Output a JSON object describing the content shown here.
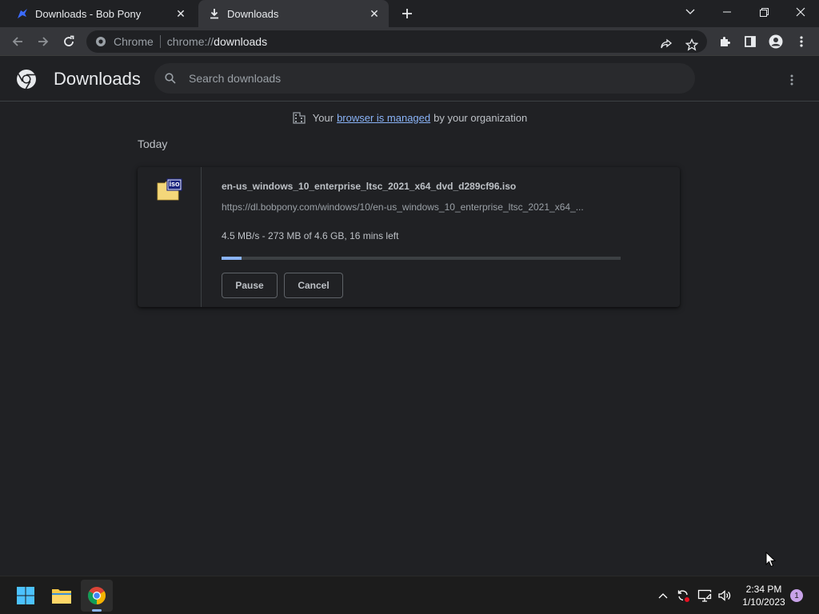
{
  "tabs": [
    {
      "title": "Downloads - Bob Pony",
      "close": "✕"
    },
    {
      "title": "Downloads",
      "close": "✕"
    }
  ],
  "new_tab": "+",
  "omnibox": {
    "site_name": "Chrome",
    "url_scheme": "chrome://",
    "url_host": "downloads"
  },
  "page": {
    "title": "Downloads",
    "search_placeholder": "Search downloads"
  },
  "managed_notice": {
    "prefix": "Your",
    "link": "browser is managed",
    "suffix": "by your organization"
  },
  "section_date": "Today",
  "download": {
    "filename": "en-us_windows_10_enterprise_ltsc_2021_x64_dvd_d289cf96.iso",
    "url": "https://dl.bobpony.com/windows/10/en-us_windows_10_enterprise_ltsc_2021_x64_...",
    "status": "4.5 MB/s - 273 MB of 4.6 GB, 16 mins left",
    "progress_fraction": 0.05,
    "pause_label": "Pause",
    "cancel_label": "Cancel",
    "file_icon_label": "iso"
  },
  "taskbar": {
    "time": "2:34 PM",
    "date": "1/10/2023",
    "notification_count": "1"
  },
  "colors": {
    "accent": "#8ab4f8",
    "background": "#202124",
    "toolbar": "#35363a"
  }
}
